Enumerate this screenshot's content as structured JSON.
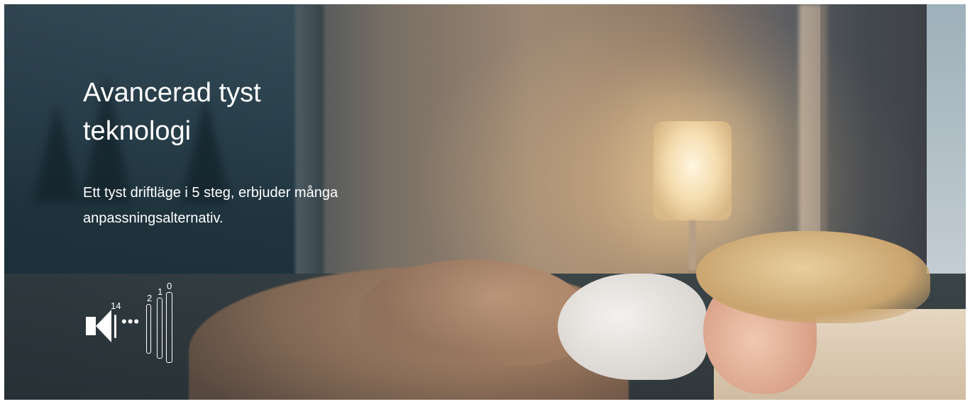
{
  "hero": {
    "title": "Avancerad tyst teknologi",
    "description": "Ett tyst driftläge i 5 steg, erbjuder många anpassningsalternativ."
  },
  "volume_indicator": {
    "icon": "speaker-icon",
    "labels": [
      "14",
      "2",
      "1",
      "0"
    ],
    "ellipsis": "•••"
  },
  "colors": {
    "text": "#ffffff",
    "window_blue": "#2b4551",
    "lamp_glow": "#f4dcae"
  }
}
